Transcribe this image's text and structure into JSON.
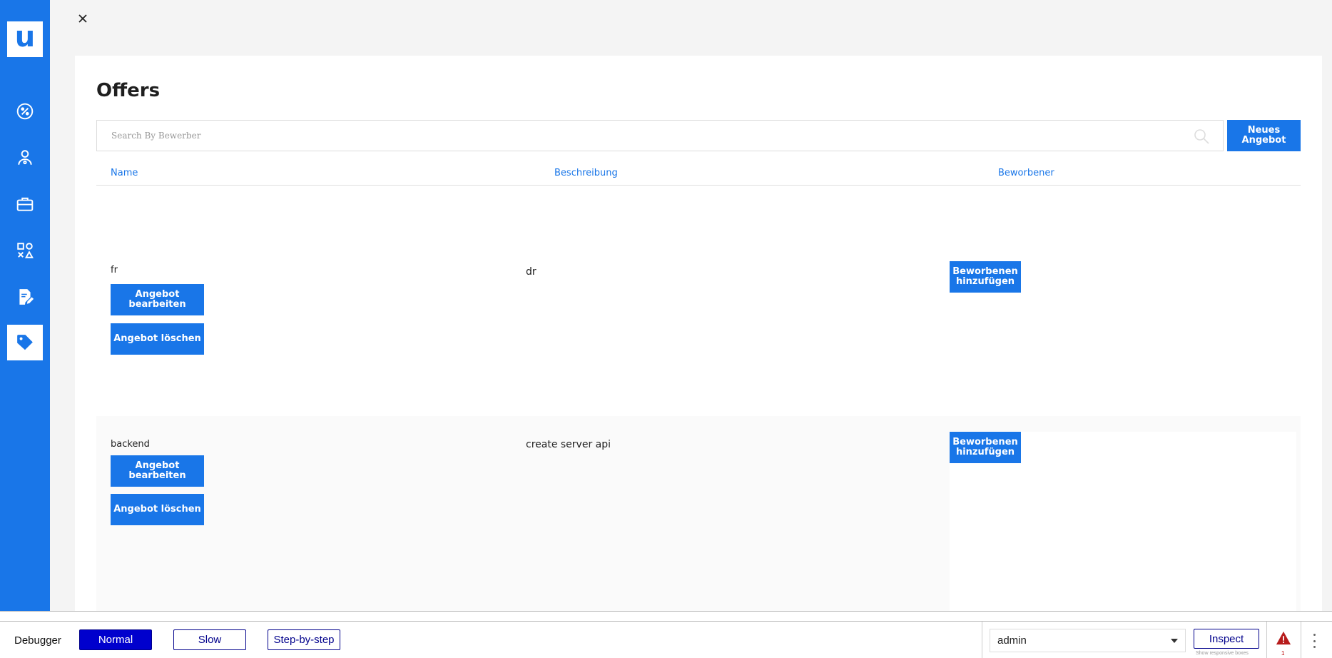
{
  "sidebar": {
    "logo_letter": "u",
    "items": [
      {
        "icon": "percent-badge-icon",
        "active": false
      },
      {
        "icon": "user-network-icon",
        "active": false
      },
      {
        "icon": "briefcase-icon",
        "active": false
      },
      {
        "icon": "shapes-icon",
        "active": false
      },
      {
        "icon": "document-edit-icon",
        "active": false
      },
      {
        "icon": "tag-icon",
        "active": true
      }
    ]
  },
  "close_icon": "close-icon",
  "page": {
    "title": "Offers",
    "search_placeholder": "Search By Bewerber",
    "new_offer_label": "Neues Angebot"
  },
  "table": {
    "headers": [
      "Name",
      "Beschreibung",
      "Beworbener"
    ],
    "rows": [
      {
        "name": "fr",
        "description": "dr",
        "edit_label": "Angebot bearbeiten",
        "delete_label": "Angebot löschen",
        "add_applicant_label": "Beworbenen hinzufügen"
      },
      {
        "name": "backend",
        "description": "create server api",
        "edit_label": "Angebot bearbeiten",
        "delete_label": "Angebot löschen",
        "add_applicant_label": "Beworbenen hinzufügen"
      }
    ]
  },
  "debugger": {
    "label": "Debugger",
    "modes": [
      "Normal",
      "Slow",
      "Step-by-step"
    ],
    "active_mode": "Normal",
    "user": "admin",
    "inspect_label": "Inspect",
    "responsive_note": "Show responsive boxes",
    "warning_count": "1"
  },
  "colors": {
    "accent": "#1976e8",
    "debugger_active": "#0000cd",
    "warning": "#b71c1c"
  }
}
